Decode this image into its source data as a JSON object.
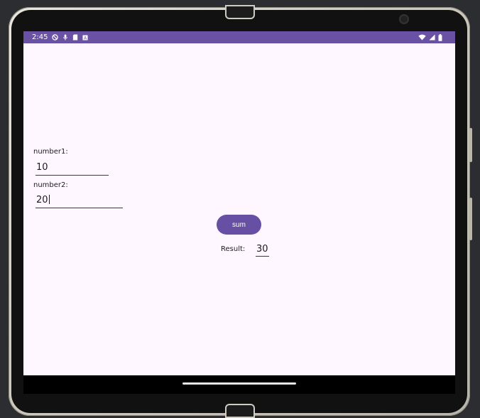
{
  "statusbar": {
    "time": "2:45",
    "icons_left": [
      "no-disturb-icon",
      "mic-icon",
      "sd-card-icon",
      "notification-box-icon"
    ],
    "icons_right": [
      "wifi-icon",
      "signal-icon",
      "battery-icon"
    ]
  },
  "form": {
    "number1_label": "number1:",
    "number1_value": "10",
    "number2_label": "number2:",
    "number2_value": "20",
    "sum_label": "sum",
    "result_label": "Result:",
    "result_value": "30"
  },
  "colors": {
    "status_bar": "#6a51a4",
    "button": "#6750a4",
    "background": "#fef7ff"
  }
}
